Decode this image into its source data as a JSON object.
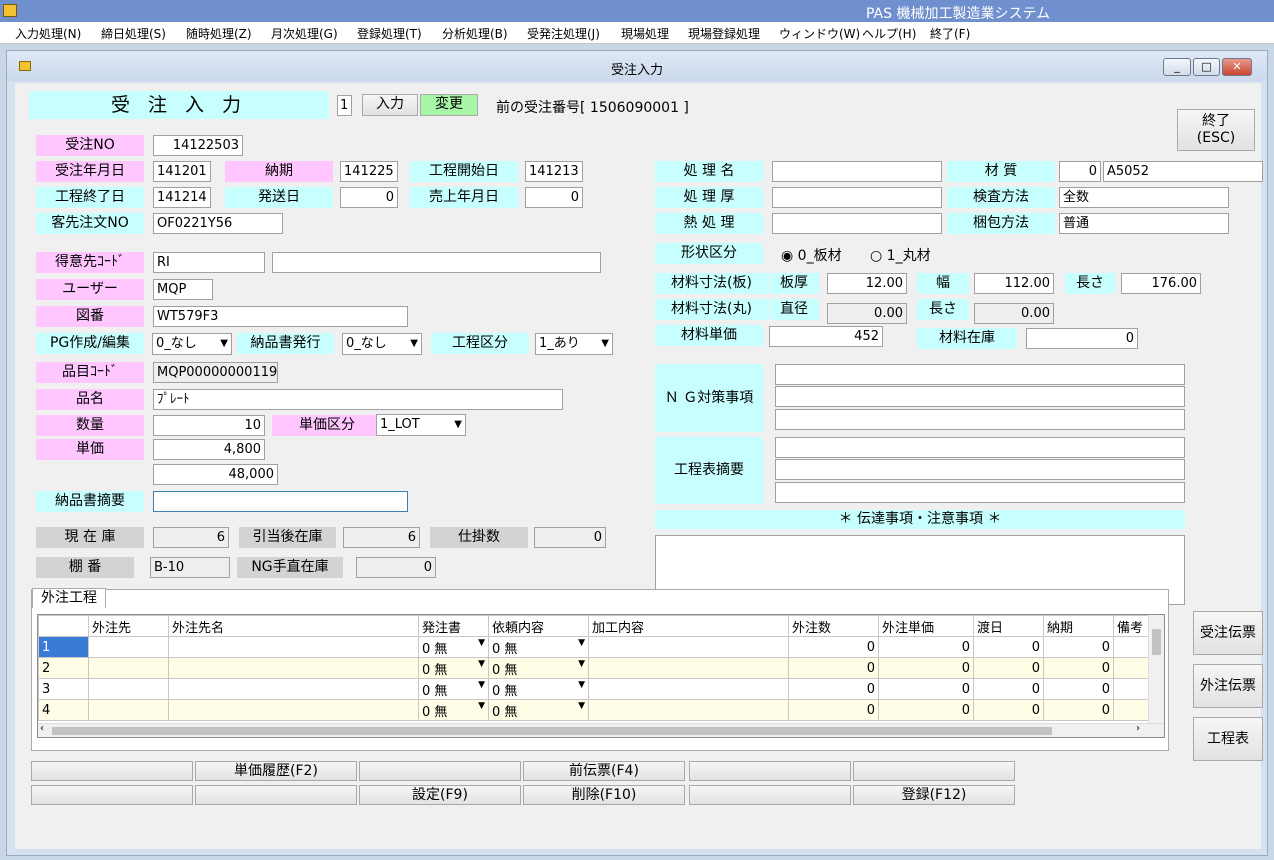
{
  "app": {
    "title": "PAS 機械加工製造業システム"
  },
  "menu": [
    "入力処理(N)",
    "締日処理(S)",
    "随時処理(Z)",
    "月次処理(G)",
    "登録処理(T)",
    "分析処理(B)",
    "受発注処理(J)",
    "現場処理",
    "現場登録処理",
    "ウィンドウ(W)",
    "ヘルプ(H)",
    "終了(F)"
  ],
  "window": {
    "title": "受注入力",
    "btn_min": "_",
    "btn_max": "□",
    "btn_close": "✕"
  },
  "header": {
    "form_title": "受 注 入 力",
    "mode_num": "1",
    "btn_input": "入力",
    "btn_change": "変更",
    "prev_label": "前の受注番号[ 1506090001 ]",
    "end_button": "終了\n(ESC)"
  },
  "left": {
    "order_no": {
      "label": "受注NO",
      "value": "14122503"
    },
    "order_date": {
      "label": "受注年月日",
      "value": "141201"
    },
    "delivery": {
      "label": "納期",
      "value": "141225"
    },
    "proc_start": {
      "label": "工程開始日",
      "value": "141213"
    },
    "proc_end": {
      "label": "工程終了日",
      "value": "141214"
    },
    "ship_date": {
      "label": "発送日",
      "value": "0"
    },
    "sales_date": {
      "label": "売上年月日",
      "value": "0"
    },
    "client_order": {
      "label": "客先注文NO",
      "value": "OF0221Y56"
    },
    "customer": {
      "label": "得意先ｺｰﾄﾞ",
      "value": "RI",
      "name": ""
    },
    "user": {
      "label": "ユーザー",
      "value": "MQP"
    },
    "drawing": {
      "label": "図番",
      "value": "WT579F3"
    },
    "pg": {
      "label": "PG作成/編集",
      "value": "0_なし"
    },
    "dn_issue": {
      "label": "納品書発行",
      "value": "0_なし"
    },
    "proc_class": {
      "label": "工程区分",
      "value": "1_あり"
    },
    "item_code": {
      "label": "品目ｺｰﾄﾞ",
      "value": "MQP00000000119"
    },
    "item_name": {
      "label": "品名",
      "value": "ﾌﾟﾚｰﾄ"
    },
    "qty": {
      "label": "数量",
      "value": "10"
    },
    "unit_class": {
      "label": "単価区分",
      "value": "1_LOT"
    },
    "price": {
      "label": "単価",
      "value": "4,800",
      "amount": "48,000"
    },
    "dn_note": {
      "label": "納品書摘要",
      "value": ""
    },
    "stock": {
      "label": "現 在 庫",
      "value": "6"
    },
    "after_alloc": {
      "label": "引当後在庫",
      "value": "6"
    },
    "wip": {
      "label": "仕掛数",
      "value": "0"
    },
    "shelf": {
      "label": "棚 番",
      "value": "B-10"
    },
    "ng_stock": {
      "label": "NG手直在庫",
      "value": "0"
    }
  },
  "right": {
    "proc_name": {
      "label": "処 理 名",
      "value": ""
    },
    "material": {
      "label": "材 質",
      "code": "0",
      "value": "A5052"
    },
    "proc_thick": {
      "label": "処 理 厚",
      "value": ""
    },
    "inspect": {
      "label": "検査方法",
      "value": "全数"
    },
    "heat": {
      "label": "熱 処 理",
      "value": ""
    },
    "pack": {
      "label": "梱包方法",
      "value": "普通"
    },
    "shape": {
      "label": "形状区分",
      "opt1": "0_板材",
      "opt2": "1_丸材"
    },
    "size_plate": {
      "label": "材料寸法(板)",
      "l1": "板厚",
      "v1": "12.00",
      "l2": "幅",
      "v2": "112.00",
      "l3": "長さ",
      "v3": "176.00"
    },
    "size_round": {
      "label": "材料寸法(丸)",
      "l1": "直径",
      "v1": "0.00",
      "l2": "長さ",
      "v2": "0.00"
    },
    "mat_price": {
      "label": "材料単価",
      "value": "452"
    },
    "mat_stock": {
      "label": "材料在庫",
      "value": "0"
    },
    "ng_label": "Ｎ Ｇ対策事項",
    "proc_note_label": "工程表摘要",
    "notice_label": "＊ 伝達事項・注意事項 ＊"
  },
  "outsource": {
    "tab": "外注工程",
    "columns": [
      "",
      "外注先",
      "外注先名",
      "発注書",
      "依頼内容",
      "加工内容",
      "外注数",
      "外注単価",
      "渡日",
      "納期",
      "備考"
    ],
    "rows": [
      {
        "no": "1",
        "order": "0 無",
        "req": "0 無",
        "qty": "0",
        "price": "0",
        "hand": "0",
        "due": "0"
      },
      {
        "no": "2",
        "order": "0 無",
        "req": "0 無",
        "qty": "0",
        "price": "0",
        "hand": "0",
        "due": "0"
      },
      {
        "no": "3",
        "order": "0 無",
        "req": "0 無",
        "qty": "0",
        "price": "0",
        "hand": "0",
        "due": "0"
      },
      {
        "no": "4",
        "order": "0 無",
        "req": "0 無",
        "qty": "0",
        "price": "0",
        "hand": "0",
        "due": "0"
      }
    ]
  },
  "side_buttons": [
    "受注伝票",
    "外注伝票",
    "工程表"
  ],
  "fkeys": {
    "row1": [
      "",
      "単価履歴(F2)",
      "",
      "前伝票(F4)",
      "",
      ""
    ],
    "row2": [
      "",
      "",
      "設定(F9)",
      "削除(F10)",
      "",
      "登録(F12)"
    ]
  }
}
